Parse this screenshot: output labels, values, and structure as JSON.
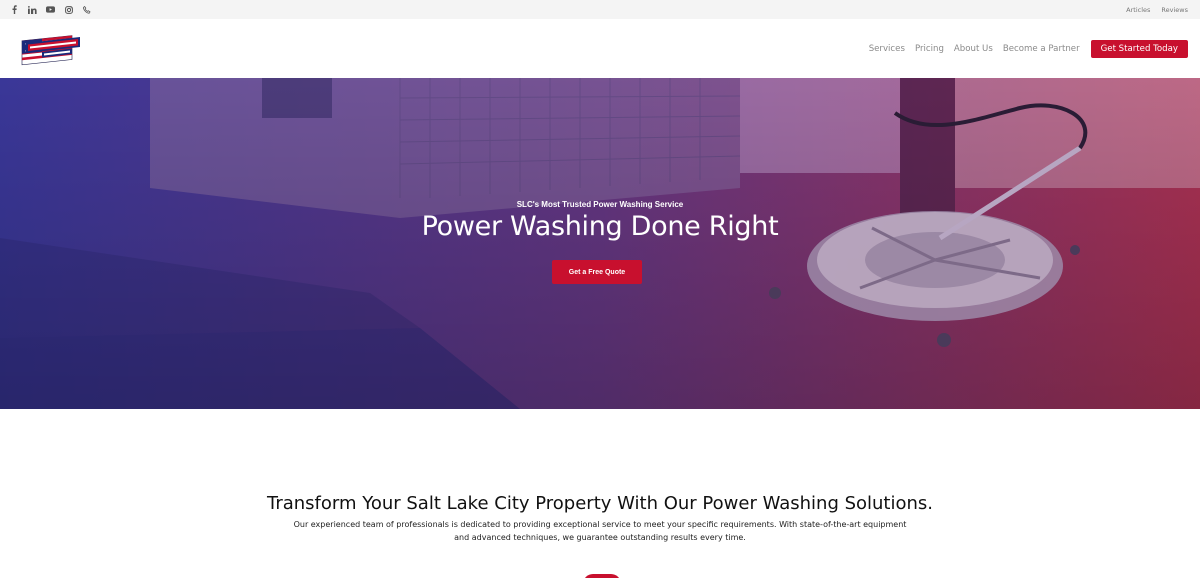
{
  "topbar": {
    "social_icons": [
      "facebook-icon",
      "linkedin-icon",
      "youtube-icon",
      "instagram-icon",
      "phone-icon"
    ],
    "links": [
      "Articles",
      "Reviews"
    ]
  },
  "header": {
    "logo_text": "Power Stream USA LLC",
    "nav": [
      "Services",
      "Pricing",
      "About Us",
      "Become a Partner"
    ],
    "cta": "Get Started Today"
  },
  "hero": {
    "kicker": "SLC's Most Trusted Power Washing Service",
    "title": "Power Washing Done Right",
    "button": "Get a Free Quote"
  },
  "intro": {
    "title": "Transform Your Salt Lake City Property With Our Power Washing Solutions.",
    "text": "Our experienced team of professionals is dedicated to providing exceptional service to meet your specific requirements. With state-of-the-art equipment and advanced techniques, we guarantee outstanding results every time."
  },
  "colors": {
    "accent": "#c8102e",
    "overlay_left": "#3d3a9e",
    "overlay_right": "#b0305a"
  }
}
